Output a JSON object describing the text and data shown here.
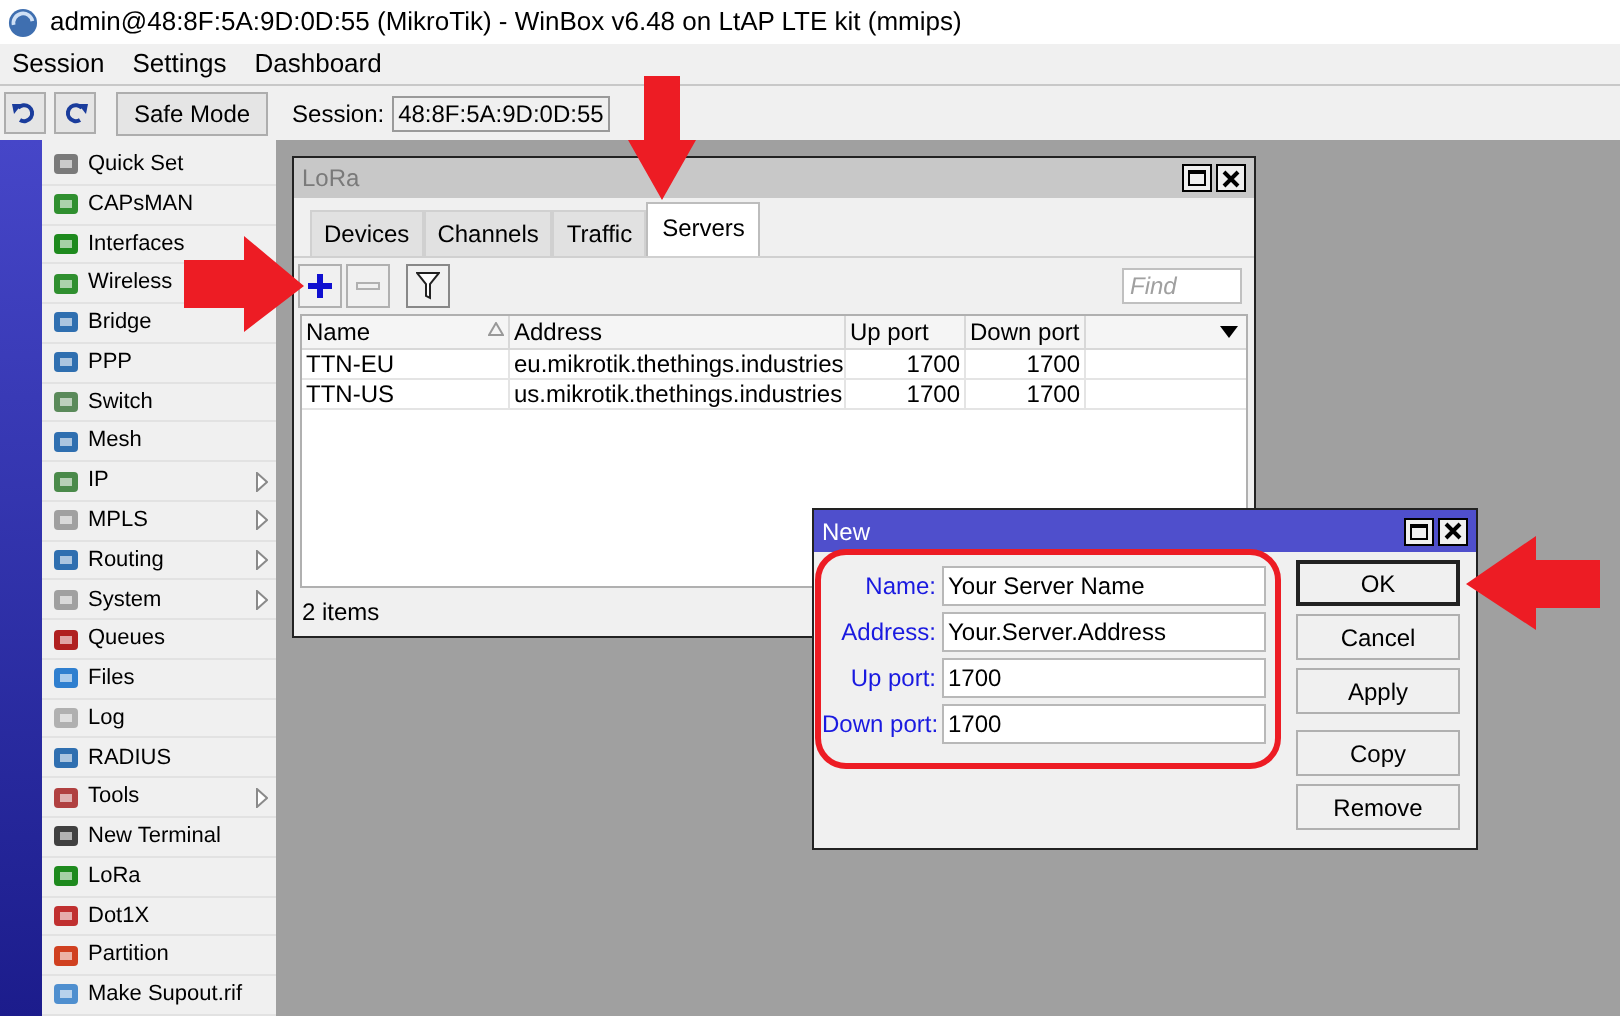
{
  "window": {
    "title": "admin@48:8F:5A:9D:0D:55 (MikroTik) - WinBox v6.48 on LtAP LTE kit (mmips)"
  },
  "menu_bar": [
    "Session",
    "Settings",
    "Dashboard"
  ],
  "toolbar": {
    "safe_mode": "Safe Mode",
    "session_label": "Session:",
    "session_value": "48:8F:5A:9D:0D:55"
  },
  "sidebar": {
    "items": [
      {
        "label": "Quick Set",
        "submenu": false
      },
      {
        "label": "CAPsMAN",
        "submenu": false
      },
      {
        "label": "Interfaces",
        "submenu": false
      },
      {
        "label": "Wireless",
        "submenu": false
      },
      {
        "label": "Bridge",
        "submenu": false
      },
      {
        "label": "PPP",
        "submenu": false
      },
      {
        "label": "Switch",
        "submenu": false
      },
      {
        "label": "Mesh",
        "submenu": false
      },
      {
        "label": "IP",
        "submenu": true
      },
      {
        "label": "MPLS",
        "submenu": true
      },
      {
        "label": "Routing",
        "submenu": true
      },
      {
        "label": "System",
        "submenu": true
      },
      {
        "label": "Queues",
        "submenu": false
      },
      {
        "label": "Files",
        "submenu": false
      },
      {
        "label": "Log",
        "submenu": false
      },
      {
        "label": "RADIUS",
        "submenu": false
      },
      {
        "label": "Tools",
        "submenu": true
      },
      {
        "label": "New Terminal",
        "submenu": false
      },
      {
        "label": "LoRa",
        "submenu": false
      },
      {
        "label": "Dot1X",
        "submenu": false
      },
      {
        "label": "Partition",
        "submenu": false
      },
      {
        "label": "Make Supout.rif",
        "submenu": false
      }
    ]
  },
  "lora_window": {
    "title": "LoRa",
    "tabs": [
      {
        "label": "Devices",
        "selected": false
      },
      {
        "label": "Channels",
        "selected": false
      },
      {
        "label": "Traffic",
        "selected": false
      },
      {
        "label": "Servers",
        "selected": true
      }
    ],
    "find": {
      "placeholder": "Find"
    },
    "table": {
      "columns": [
        "Name",
        "Address",
        "Up port",
        "Down port"
      ],
      "rows": [
        [
          "TTN-EU",
          "eu.mikrotik.thethings.industries",
          "1700",
          "1700"
        ],
        [
          "TTN-US",
          "us.mikrotik.thethings.industries",
          "1700",
          "1700"
        ]
      ]
    },
    "status": "2 items"
  },
  "new_dialog": {
    "title": "New",
    "fields": [
      {
        "label": "Name:",
        "value": "Your Server Name"
      },
      {
        "label": "Address:",
        "value": "Your.Server.Address"
      },
      {
        "label": "Up port:",
        "value": "1700"
      },
      {
        "label": "Down port:",
        "value": "1700"
      }
    ],
    "buttons": [
      {
        "label": "OK",
        "default": true
      },
      {
        "label": "Cancel",
        "default": false
      },
      {
        "label": "Apply",
        "default": false
      },
      {
        "label": "Copy",
        "default": false
      },
      {
        "label": "Remove",
        "default": false
      }
    ]
  }
}
